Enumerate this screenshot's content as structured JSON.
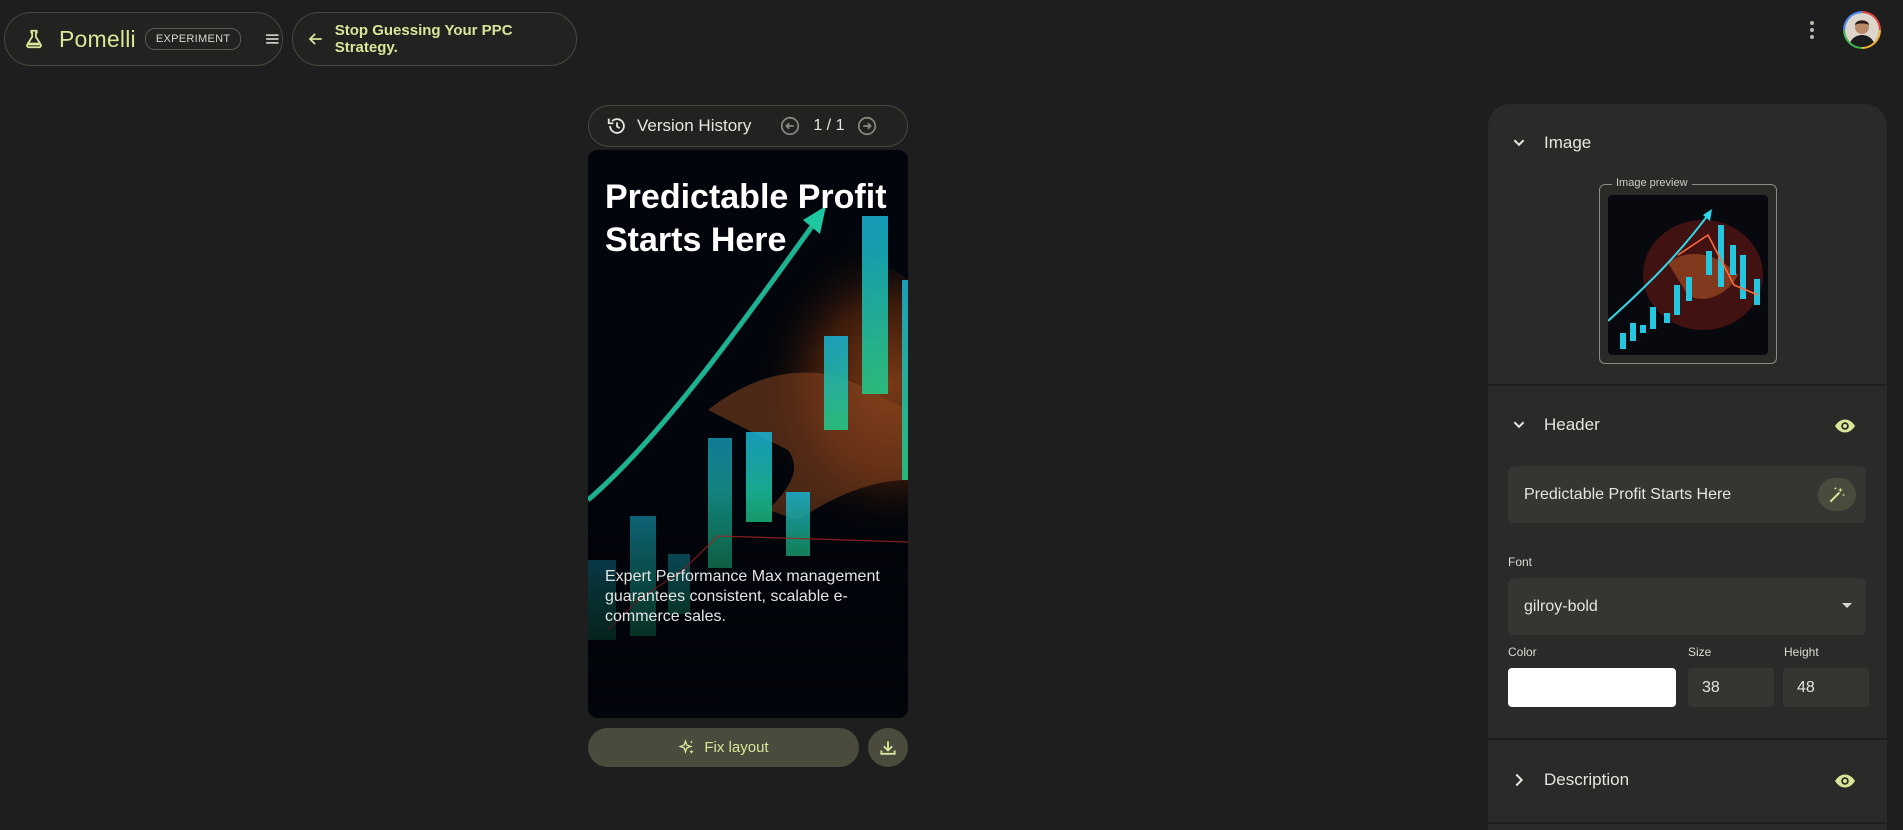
{
  "app": {
    "brand_name": "Pomelli",
    "badge": "EXPERIMENT",
    "back_label": "Stop Guessing Your PPC Strategy."
  },
  "version_bar": {
    "label": "Version History",
    "counter": "1 / 1"
  },
  "card": {
    "title": "Predictable Profit Starts Here",
    "description": "Expert Performance Max management guarantees consistent, scalable e-commerce sales."
  },
  "actions": {
    "fix_layout": "Fix layout"
  },
  "panel": {
    "image_section": {
      "title": "Image",
      "preview_label": "Image preview"
    },
    "header_section": {
      "title": "Header",
      "text_value": "Predictable Profit Starts Here",
      "font_label": "Font",
      "font_value": "gilroy-bold",
      "color_label": "Color",
      "color_value": "#ffffff",
      "size_label": "Size",
      "size_value": "38",
      "height_label": "Height",
      "height_value": "48"
    },
    "description_section": {
      "title": "Description"
    }
  },
  "colors": {
    "background": "#1e1e1e",
    "accent": "#d8e69a",
    "panel": "#2a2a28",
    "button": "#4a4a3d"
  },
  "icons": [
    "flask-icon",
    "menu-icon",
    "arrow-left-icon",
    "more-vert-icon",
    "history-icon",
    "arrow-circle-left-icon",
    "arrow-circle-right-icon",
    "sparkle-icon",
    "download-icon",
    "chevron-down-icon",
    "chevron-right-icon",
    "eye-icon",
    "magic-wand-icon"
  ]
}
